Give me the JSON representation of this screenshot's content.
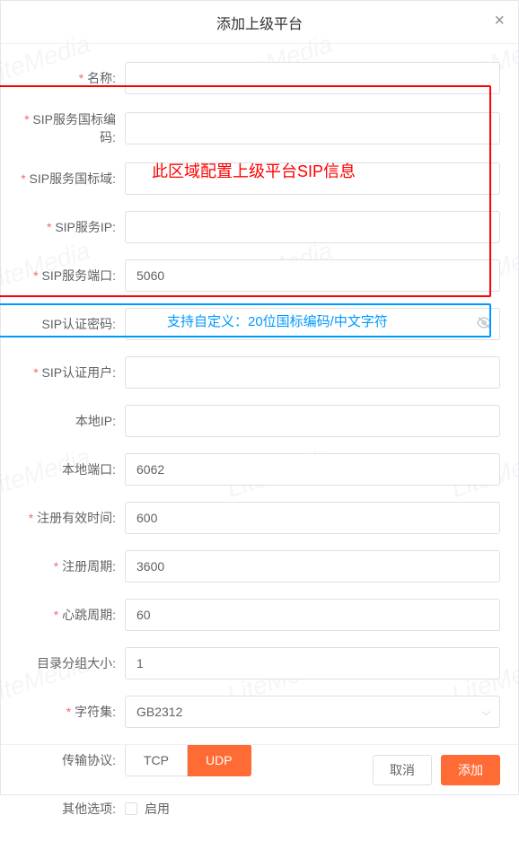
{
  "dialog": {
    "title": "添加上级平台",
    "close": "×"
  },
  "form": {
    "name": {
      "label": "名称:",
      "value": ""
    },
    "sipCode": {
      "label": "SIP服务国标编码:",
      "value": ""
    },
    "sipDomain": {
      "label": "SIP服务国标域:",
      "value": ""
    },
    "sipIp": {
      "label": "SIP服务IP:",
      "value": ""
    },
    "sipPort": {
      "label": "SIP服务端口:",
      "value": "5060"
    },
    "sipPassword": {
      "label": "SIP认证密码:",
      "value": ""
    },
    "sipUser": {
      "label": "SIP认证用户:",
      "value": ""
    },
    "localIp": {
      "label": "本地IP:",
      "value": ""
    },
    "localPort": {
      "label": "本地端口:",
      "value": "6062"
    },
    "regValid": {
      "label": "注册有效时间:",
      "value": "600"
    },
    "regInterval": {
      "label": "注册周期:",
      "value": "3600"
    },
    "heartbeat": {
      "label": "心跳周期:",
      "value": "60"
    },
    "groupSize": {
      "label": "目录分组大小:",
      "value": "1"
    },
    "charset": {
      "label": "字符集:",
      "value": "GB2312"
    },
    "protocol": {
      "label": "传输协议:",
      "tcp": "TCP",
      "udp": "UDP"
    },
    "other": {
      "label": "其他选项:",
      "enable": "启用"
    }
  },
  "annotations": {
    "redText": "此区域配置上级平台SIP信息",
    "blueText": "支持自定义：20位国标编码/中文字符"
  },
  "footer": {
    "cancel": "取消",
    "submit": "添加"
  },
  "watermark": "LiteMedia"
}
